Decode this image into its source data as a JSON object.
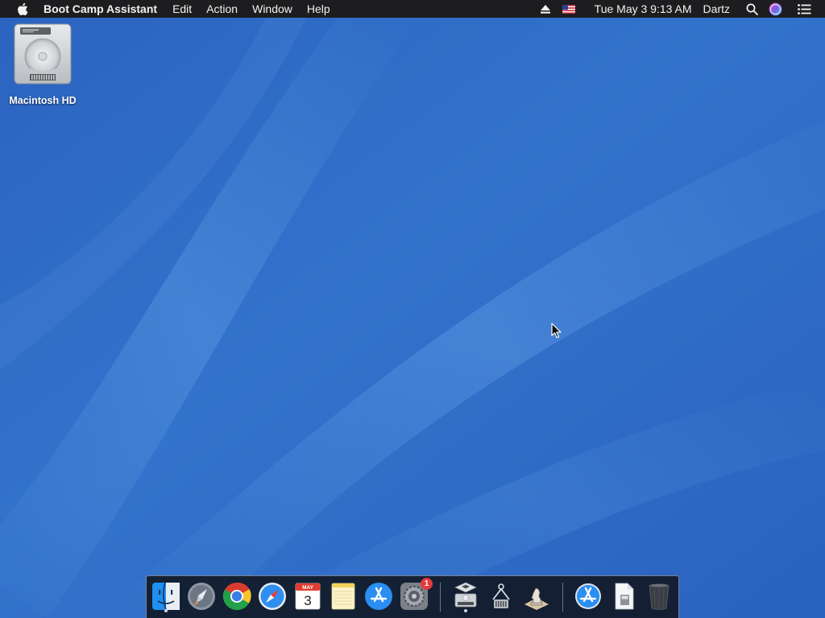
{
  "menubar": {
    "app_name": "Boot Camp Assistant",
    "menus": [
      "Edit",
      "Action",
      "Window",
      "Help"
    ],
    "clock": "Tue May 3  9:13 AM",
    "user": "Dartz",
    "status_icons": [
      "eject-icon",
      "us-flag-input-icon",
      "search-icon",
      "siri-icon",
      "notification-center-icon"
    ]
  },
  "desktop": {
    "icons": [
      {
        "label": "Macintosh HD",
        "icon": "hard-drive-icon"
      }
    ]
  },
  "dock": {
    "apps": [
      {
        "name": "Finder",
        "icon": "finder-icon",
        "running": true
      },
      {
        "name": "Launchpad",
        "icon": "launchpad-icon",
        "running": false
      },
      {
        "name": "Google Chrome",
        "icon": "chrome-icon",
        "running": false
      },
      {
        "name": "Safari",
        "icon": "safari-icon",
        "running": false
      },
      {
        "name": "Calendar",
        "icon": "calendar-icon",
        "running": false,
        "month": "MAY",
        "day": "3"
      },
      {
        "name": "Notes",
        "icon": "notes-icon",
        "running": false
      },
      {
        "name": "App Store",
        "icon": "app-store-icon",
        "running": false
      },
      {
        "name": "System Preferences",
        "icon": "system-preferences-icon",
        "running": false,
        "badge": "1"
      },
      {
        "name": "Boot Camp Assistant",
        "icon": "boot-camp-icon",
        "running": true
      },
      {
        "name": "Directory Utility",
        "icon": "directory-utility-icon",
        "running": false
      },
      {
        "name": "Chess",
        "icon": "chess-icon",
        "running": false
      },
      {
        "name": "Applications",
        "icon": "applications-folder-icon",
        "running": false
      },
      {
        "name": "Document",
        "icon": "document-icon",
        "running": false
      },
      {
        "name": "Trash",
        "icon": "trash-icon",
        "running": false
      }
    ]
  },
  "colors": {
    "menubar_bg": "#1d1d1f",
    "desktop_blue": "#2d6bc8",
    "badge_red": "#e5393a"
  }
}
